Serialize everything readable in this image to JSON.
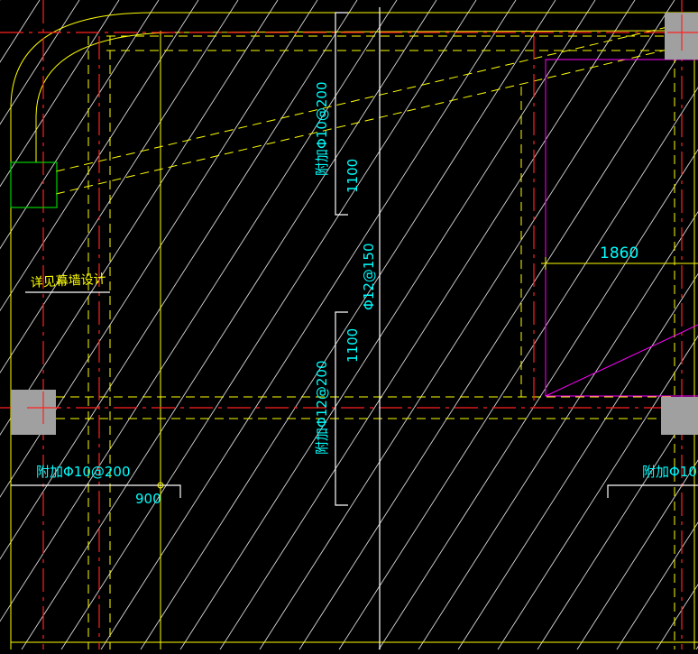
{
  "colors": {
    "background": "#000000",
    "hatch": "#ffffff",
    "yellow": "#ffff00",
    "red": "#ff2020",
    "cyan": "#00ffff",
    "magenta": "#ff00ff",
    "green": "#00d000",
    "column": "#a0a0a0"
  },
  "labels": {
    "rebar_top_extra": "附加Φ10@200",
    "rebar_top_len": "1100",
    "rebar_main": "Φ12@150",
    "rebar_mid_len": "1100",
    "rebar_mid_extra": "附加Φ12@200",
    "curtain_wall": "详见幕墙设计",
    "rebar_left_extra": "附加Φ10@200",
    "dim_900": "900",
    "rebar_right_extra": "附加Φ10@",
    "dim_1860": "1860"
  }
}
